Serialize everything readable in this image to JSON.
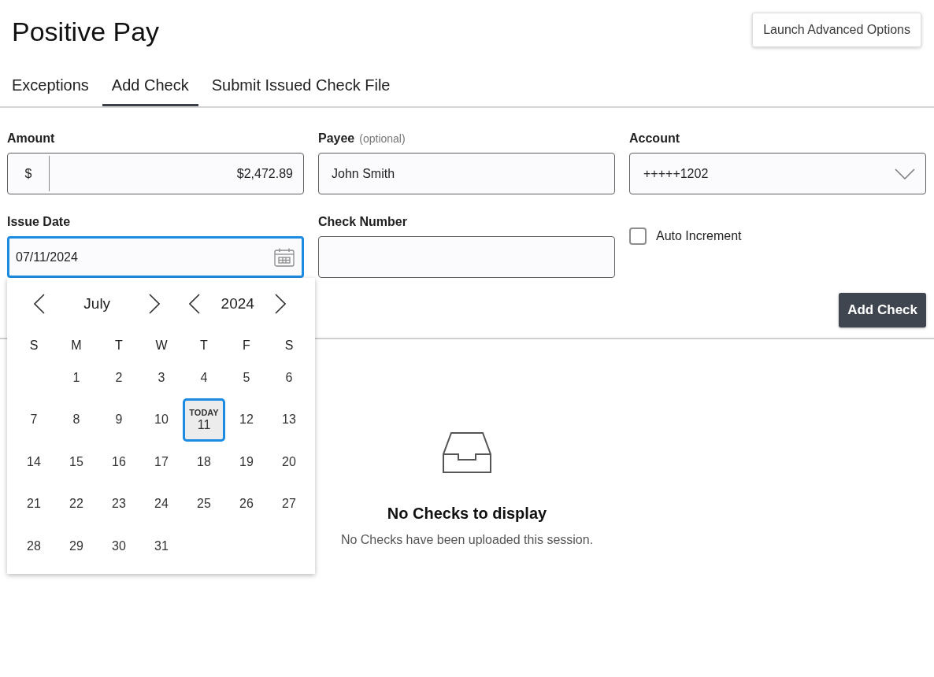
{
  "header": {
    "title": "Positive Pay",
    "button": "Launch Advanced Options"
  },
  "tabs": [
    {
      "label": "Exceptions",
      "selected": false
    },
    {
      "label": "Add Check",
      "selected": true
    },
    {
      "label": "Submit Issued Check File",
      "selected": false
    }
  ],
  "form": {
    "fields": [
      {
        "kind": "currency",
        "label": "Amount",
        "prefix": "$",
        "value": "$2,472.89"
      },
      {
        "kind": "text",
        "label": "Payee",
        "note": "(optional)",
        "value": "John Smith"
      },
      {
        "kind": "select",
        "label": "Account",
        "value": "+++++1202"
      },
      {
        "kind": "date",
        "label": "Issue Date",
        "value": "07/11/2024",
        "focused": true,
        "picker": {
          "month": "July",
          "year": "2024",
          "today_label": "TODAY",
          "weekdays": [
            "S",
            "M",
            "T",
            "W",
            "T",
            "F",
            "S"
          ],
          "weeks": [
            {
              "days": [
                {
                  "label": "1",
                  "selected": false,
                  "today": false
                },
                {
                  "label": "2",
                  "selected": false,
                  "today": false
                },
                {
                  "label": "3",
                  "selected": false,
                  "today": false
                },
                {
                  "label": "4",
                  "selected": false,
                  "today": false
                },
                {
                  "label": "5",
                  "selected": false,
                  "today": false
                },
                {
                  "label": "6",
                  "selected": false,
                  "today": false
                }
              ]
            },
            {
              "days": [
                {
                  "label": "7",
                  "selected": false,
                  "today": false
                },
                {
                  "label": "8",
                  "selected": false,
                  "today": false
                },
                {
                  "label": "9",
                  "selected": false,
                  "today": false
                },
                {
                  "label": "10",
                  "selected": false,
                  "today": false
                },
                {
                  "label": "11",
                  "selected": true,
                  "today": true
                },
                {
                  "label": "12",
                  "selected": false,
                  "today": false
                },
                {
                  "label": "13",
                  "selected": false,
                  "today": false
                }
              ]
            },
            {
              "days": [
                {
                  "label": "14",
                  "selected": false,
                  "today": false
                },
                {
                  "label": "15",
                  "selected": false,
                  "today": false
                },
                {
                  "label": "16",
                  "selected": false,
                  "today": false
                },
                {
                  "label": "17",
                  "selected": false,
                  "today": false
                },
                {
                  "label": "18",
                  "selected": false,
                  "today": false
                },
                {
                  "label": "19",
                  "selected": false,
                  "today": false
                },
                {
                  "label": "20",
                  "selected": false,
                  "today": false
                }
              ]
            },
            {
              "days": [
                {
                  "label": "21",
                  "selected": false,
                  "today": false
                },
                {
                  "label": "22",
                  "selected": false,
                  "today": false
                },
                {
                  "label": "23",
                  "selected": false,
                  "today": false
                },
                {
                  "label": "24",
                  "selected": false,
                  "today": false
                },
                {
                  "label": "25",
                  "selected": false,
                  "today": false
                },
                {
                  "label": "26",
                  "selected": false,
                  "today": false
                },
                {
                  "label": "27",
                  "selected": false,
                  "today": false
                }
              ]
            },
            {
              "days": [
                {
                  "label": "28",
                  "selected": false,
                  "today": false
                },
                {
                  "label": "29",
                  "selected": false,
                  "today": false
                },
                {
                  "label": "30",
                  "selected": false,
                  "today": false
                },
                {
                  "label": "31",
                  "selected": false,
                  "today": false
                }
              ]
            }
          ]
        }
      },
      {
        "kind": "text",
        "label": "Check Number"
      },
      {
        "kind": "checkbox",
        "label": "Auto Increment",
        "checked": false
      }
    ],
    "submit_button": "Add Check"
  },
  "empty_state": {
    "title": "No Checks to display",
    "message": "No Checks have been uploaded this session."
  }
}
